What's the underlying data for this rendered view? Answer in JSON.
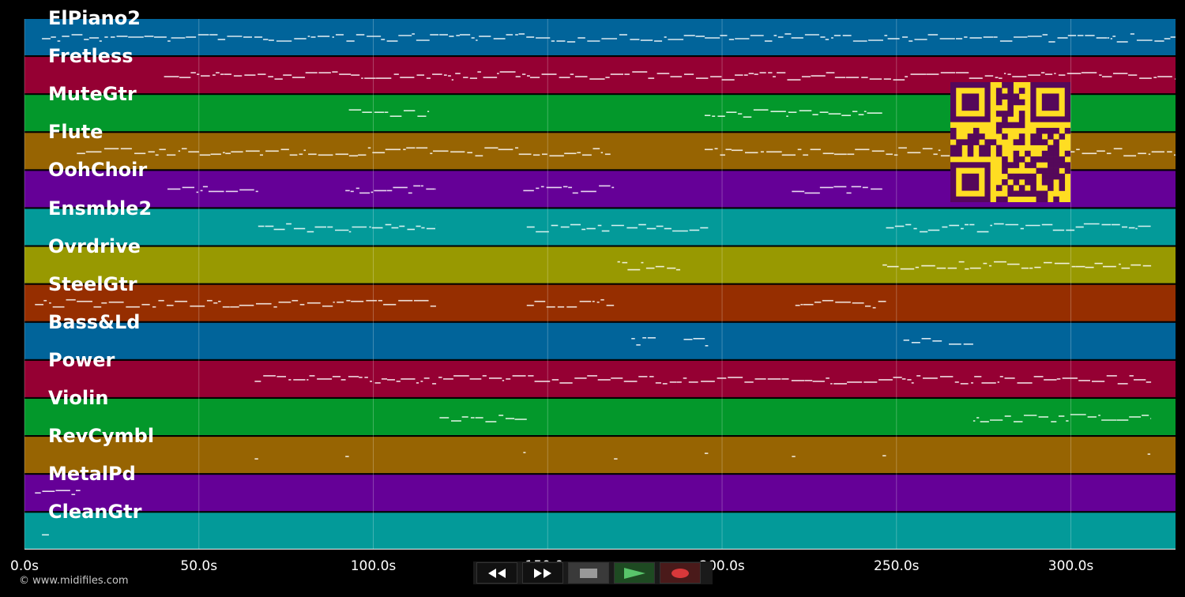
{
  "tracks": [
    {
      "name": "ElPiano2",
      "color": "#01649a"
    },
    {
      "name": "Fretless",
      "color": "#950033"
    },
    {
      "name": "MuteGtr",
      "color": "#03982b"
    },
    {
      "name": "Flute",
      "color": "#976402"
    },
    {
      "name": "OohChoir",
      "color": "#650097"
    },
    {
      "name": "Ensmble2",
      "color": "#039a99"
    },
    {
      "name": "Ovrdrive",
      "color": "#989901"
    },
    {
      "name": "SteelGtr",
      "color": "#962e00"
    },
    {
      "name": "Bass&Ld",
      "color": "#01649a"
    },
    {
      "name": "Power",
      "color": "#950033"
    },
    {
      "name": "Violin",
      "color": "#03982b"
    },
    {
      "name": "RevCymbl",
      "color": "#976402"
    },
    {
      "name": "MetalPd",
      "color": "#650097"
    },
    {
      "name": "CleanGtr",
      "color": "#039a99"
    }
  ],
  "timeline": {
    "unit": "s",
    "ticks": [
      "0.0s",
      "50.0s",
      "100.0s",
      "150.0s",
      "200.0s",
      "250.0s",
      "300.0s"
    ],
    "tick_values": [
      0,
      50,
      100,
      150,
      200,
      250,
      300
    ],
    "range": [
      0,
      330
    ]
  },
  "transport": {
    "rewind": "rewind-icon",
    "fast_forward": "fast-forward-icon",
    "stop": "stop-icon",
    "play": "play-icon",
    "record": "record-icon"
  },
  "copyright": "© www.midifiles.com",
  "qr_color": "#ffdd22",
  "qr_dark": "#55085a"
}
